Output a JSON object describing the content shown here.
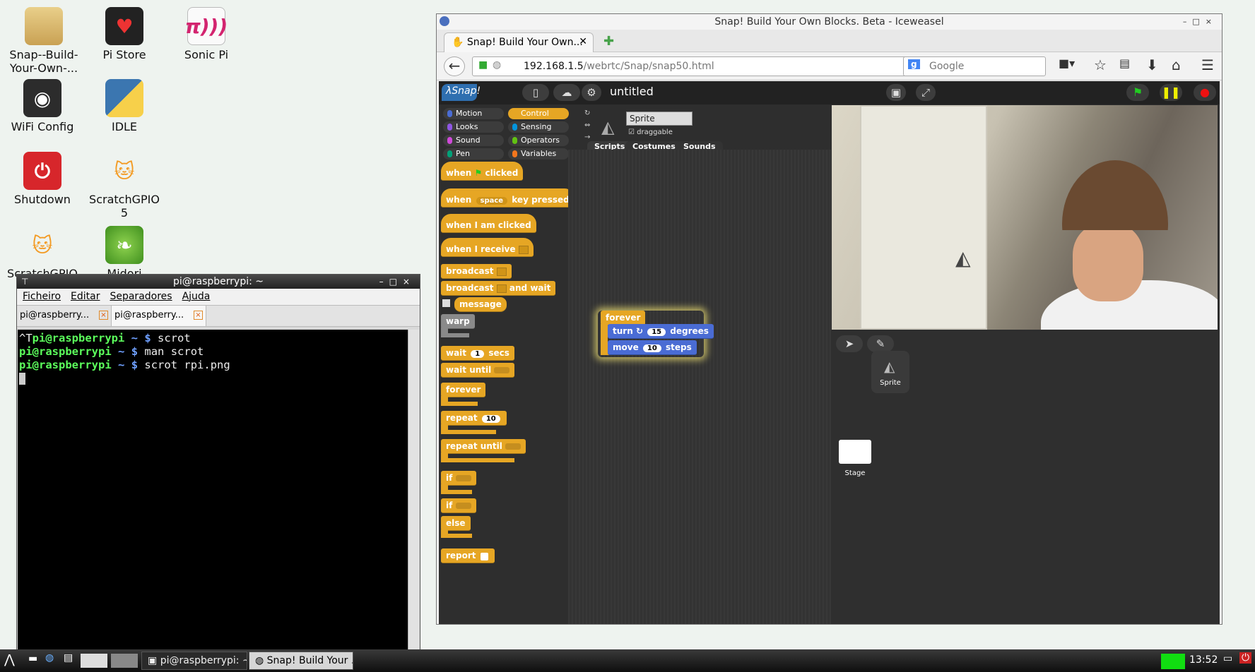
{
  "desktop": {
    "icons": [
      {
        "label": "Snap--Build-\nYour-Own-...",
        "icon": "folder-icon"
      },
      {
        "label": "Pi Store",
        "icon": "raspberry-store-icon"
      },
      {
        "label": "Sonic Pi",
        "icon": "sonic-pi-icon"
      },
      {
        "label": "WiFi Config",
        "icon": "wifi-icon"
      },
      {
        "label": "IDLE",
        "icon": "python-icon"
      },
      {
        "label": "Shutdown",
        "icon": "power-icon"
      },
      {
        "label": "ScratchGPIO\n5",
        "icon": "scratch-cat-icon"
      },
      {
        "label": "ScratchGPIO",
        "icon": "scratch-cat-icon"
      },
      {
        "label": "Midori",
        "icon": "midori-icon"
      }
    ]
  },
  "terminal": {
    "title": "pi@raspberrypi: ~",
    "menu": [
      "Ficheiro",
      "Editar",
      "Separadores",
      "Ajuda"
    ],
    "tabs": [
      "pi@raspberry...",
      "pi@raspberry..."
    ],
    "lines": [
      {
        "prefix": "^T",
        "user": "pi@raspberrypi",
        "path": "~",
        "cmd": "scrot"
      },
      {
        "prefix": "",
        "user": "pi@raspberrypi",
        "path": "~",
        "cmd": "man scrot"
      },
      {
        "prefix": "",
        "user": "pi@raspberrypi",
        "path": "~",
        "cmd": "scrot rpi.png"
      }
    ]
  },
  "browser": {
    "window_title": "Snap! Build Your Own Blocks. Beta - Iceweasel",
    "tab_title": "Snap! Build Your Own...",
    "url_host": "192.168.1.5",
    "url_path": "/webrtc/Snap/snap50.html",
    "search_placeholder": "Google"
  },
  "snap": {
    "project_title": "untitled",
    "categories": [
      {
        "label": "Motion",
        "color": "#4a6cd4"
      },
      {
        "label": "Control",
        "color": "#e6a624"
      },
      {
        "label": "Looks",
        "color": "#8f56e3"
      },
      {
        "label": "Sensing",
        "color": "#0494dc"
      },
      {
        "label": "Sound",
        "color": "#cf4ad9"
      },
      {
        "label": "Operators",
        "color": "#62c213"
      },
      {
        "label": "Pen",
        "color": "#00a178"
      },
      {
        "label": "Variables",
        "color": "#f3761d"
      }
    ],
    "active_category": "Control",
    "sprite_name": "Sprite",
    "draggable_label": "draggable",
    "tabs": [
      "Scripts",
      "Costumes",
      "Sounds"
    ],
    "palette": {
      "when_flag": [
        "when",
        "clicked"
      ],
      "when_key": [
        "when",
        "space",
        "key pressed"
      ],
      "when_clicked": "when I am clicked",
      "when_receive": "when I receive",
      "broadcast": "broadcast",
      "broadcast_wait": [
        "broadcast",
        "and wait"
      ],
      "message": "message",
      "warp": "warp",
      "wait": [
        "wait",
        "1",
        "secs"
      ],
      "wait_until": "wait until",
      "forever": "forever",
      "repeat": [
        "repeat",
        "10"
      ],
      "repeat_until": "repeat until",
      "if": "if",
      "if_else": [
        "if",
        "else"
      ],
      "report": "report"
    },
    "script": {
      "forever": "forever",
      "turn": [
        "turn",
        "15",
        "degrees"
      ],
      "move": [
        "move",
        "10",
        "steps"
      ]
    },
    "corral": {
      "sprite_label": "Sprite",
      "stage_label": "Stage"
    }
  },
  "taskbar": {
    "items": [
      "pi@raspberrypi: ~",
      "Snap! Build Your ..."
    ],
    "clock": "13:52"
  }
}
